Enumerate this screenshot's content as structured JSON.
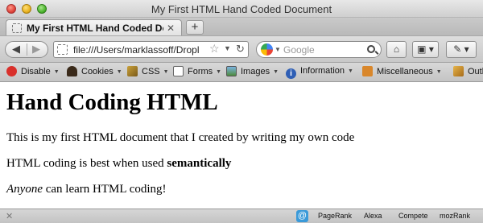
{
  "window": {
    "title": "My First HTML Hand Coded Document"
  },
  "tabs": {
    "active_title": "My First HTML Hand Coded Doc…",
    "close_glyph": "✕",
    "new_tab_glyph": "+"
  },
  "navbar": {
    "url": "file:///Users/marklassoff/Dropl",
    "search_placeholder": "Google",
    "search_engine_icon": "google-icon",
    "home_icon": "home-icon",
    "bookmarks_icon": "bookmarks-icon",
    "addon_icon": "addon-icon"
  },
  "devbar": {
    "items": [
      {
        "label": "Disable",
        "icon": "disable-icon"
      },
      {
        "label": "Cookies",
        "icon": "cookies-icon"
      },
      {
        "label": "CSS",
        "icon": "css-icon"
      },
      {
        "label": "Forms",
        "icon": "forms-icon"
      },
      {
        "label": "Images",
        "icon": "images-icon"
      },
      {
        "label": "Information",
        "icon": "information-icon"
      },
      {
        "label": "Miscellaneous",
        "icon": "miscellaneous-icon"
      },
      {
        "label": "Outlin",
        "icon": "outline-icon"
      }
    ]
  },
  "page": {
    "heading": "Hand Coding HTML",
    "paragraph1": "This is my first HTML document that I created by writing my own code",
    "paragraph2_prefix": "HTML coding is best when used ",
    "paragraph2_bold": "semantically",
    "paragraph3_italic": "Anyone",
    "paragraph3_rest": " can learn HTML coding!"
  },
  "statusbar": {
    "close_glyph": "✕",
    "items": [
      "PageRank",
      "Alexa",
      "Compete",
      "mozRank"
    ]
  },
  "colors": {
    "toolbar": "#d0d0d0",
    "content_bg": "#ffffff"
  }
}
